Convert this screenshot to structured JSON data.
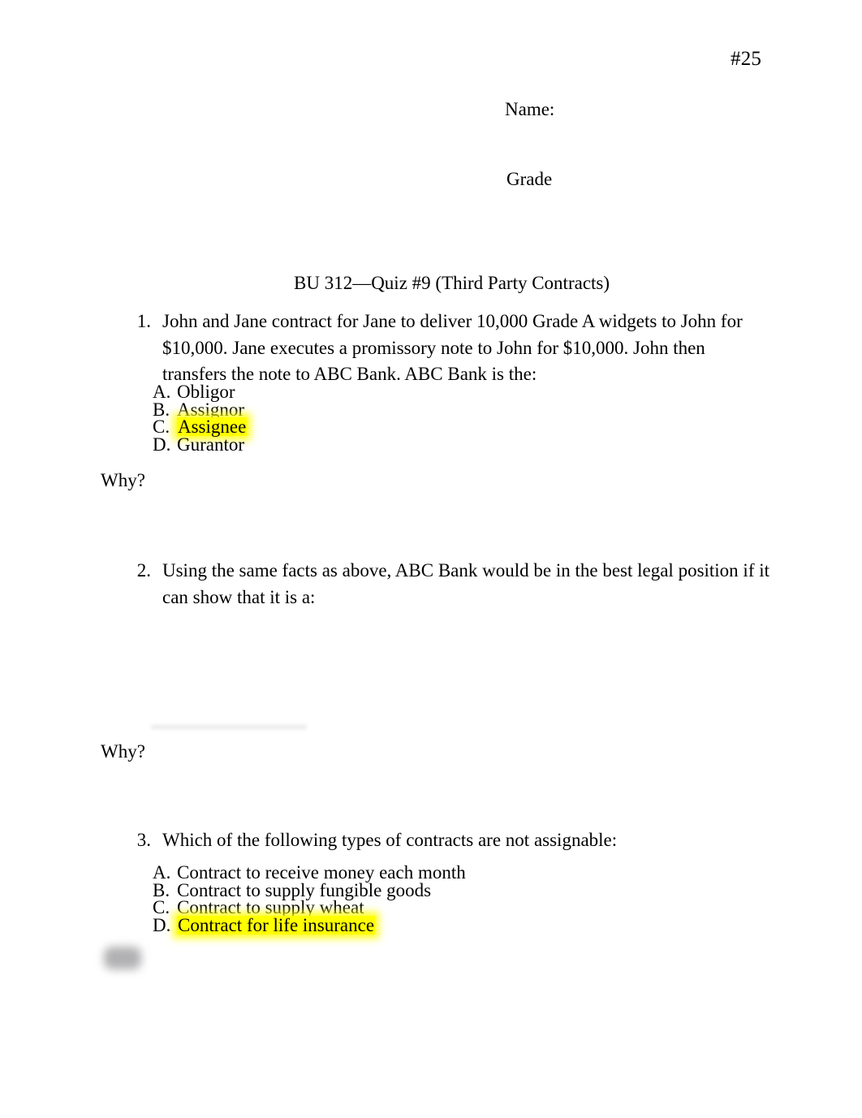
{
  "document": {
    "page_number_mark": "#25",
    "name_label": "Name:",
    "grade_label": "Grade",
    "title": "BU 312—Quiz #9 (Third Party Contracts)",
    "why_prompt_1": "Why?",
    "why_prompt_2": "Why?",
    "highlight_color": "#ffff00"
  },
  "questions": [
    {
      "number": "1.",
      "text": "John and Jane contract for Jane to deliver 10,000 Grade A widgets to John for $10,000. Jane executes a promissory note to John for $10,000.  John then transfers the note to ABC Bank. ABC Bank is the:",
      "options": [
        {
          "letter": "A.",
          "label": "Obligor",
          "highlighted": false
        },
        {
          "letter": "B.",
          "label": "Assignor",
          "highlighted": false
        },
        {
          "letter": "C.",
          "label": "Assignee",
          "highlighted": true
        },
        {
          "letter": "D.",
          "label": "Gurantor",
          "highlighted": false
        }
      ]
    },
    {
      "number": "2.",
      "text": "Using the same facts as above, ABC Bank would be in the best legal position if it can show that it is a:",
      "options": []
    },
    {
      "number": "3.",
      "text": "Which of the following types of contracts are not assignable:",
      "options": [
        {
          "letter": "A.",
          "label": "Contract to receive money each month",
          "highlighted": false
        },
        {
          "letter": "B.",
          "label": "Contract to supply fungible goods",
          "highlighted": false
        },
        {
          "letter": "C.",
          "label": "Contract to supply wheat",
          "highlighted": false
        },
        {
          "letter": "D.",
          "label": "Contract for life insurance",
          "highlighted": true
        }
      ]
    }
  ]
}
